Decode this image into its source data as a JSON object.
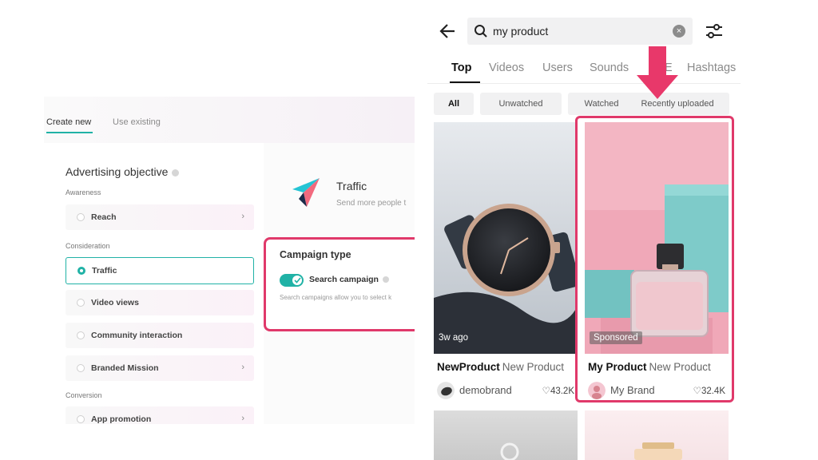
{
  "ads_manager": {
    "tabs": [
      {
        "label": "Create new",
        "active": true
      },
      {
        "label": "Use existing",
        "active": false
      }
    ],
    "section_title": "Advertising objective",
    "groups": {
      "awareness": "Awareness",
      "consideration": "Consideration",
      "conversion": "Conversion"
    },
    "options": [
      {
        "label": "Reach",
        "selected": false,
        "has_chevron": true
      },
      {
        "label": "Traffic",
        "selected": true,
        "has_chevron": false
      },
      {
        "label": "Video views",
        "selected": false,
        "has_chevron": false
      },
      {
        "label": "Community interaction",
        "selected": false,
        "has_chevron": false
      },
      {
        "label": "Branded Mission",
        "selected": false,
        "has_chevron": true
      },
      {
        "label": "App promotion",
        "selected": false,
        "has_chevron": true
      }
    ],
    "objective_detail": {
      "title": "Traffic",
      "subtitle": "Send more people t"
    },
    "campaign_type": {
      "title": "Campaign type",
      "toggle_label": "Search campaign",
      "toggle_on": true,
      "description": "Search campaigns allow you to select k"
    }
  },
  "tiktok_search": {
    "query": "my product",
    "tabs": [
      {
        "label": "Top",
        "active": true
      },
      {
        "label": "Videos",
        "active": false
      },
      {
        "label": "Users",
        "active": false
      },
      {
        "label": "Sounds",
        "active": false
      },
      {
        "label": "E",
        "active": false
      },
      {
        "label": "Hashtags",
        "active": false
      }
    ],
    "chips": [
      {
        "label": "All",
        "active": true
      },
      {
        "label": "Unwatched",
        "active": false
      },
      {
        "label": "Watched",
        "active": false
      },
      {
        "label": "Recently uploaded",
        "active": false
      }
    ],
    "results": [
      {
        "badge": "3w ago",
        "title": "NewProduct",
        "subtitle": "New Product",
        "author": "demobrand",
        "likes": "43.2K"
      },
      {
        "badge": "Sponsored",
        "title": "My Product",
        "subtitle": "New Product",
        "author": "My Brand",
        "likes": "32.4K"
      }
    ]
  },
  "colors": {
    "accent_teal": "#20b2a6",
    "highlight_pink": "#e0396a"
  },
  "icons": [
    "back-arrow-icon",
    "search-icon",
    "clear-icon",
    "filter-sliders-icon",
    "heart-icon",
    "chevron-right-icon",
    "info-icon",
    "traffic-arrow-icon",
    "pointer-arrow-icon"
  ]
}
